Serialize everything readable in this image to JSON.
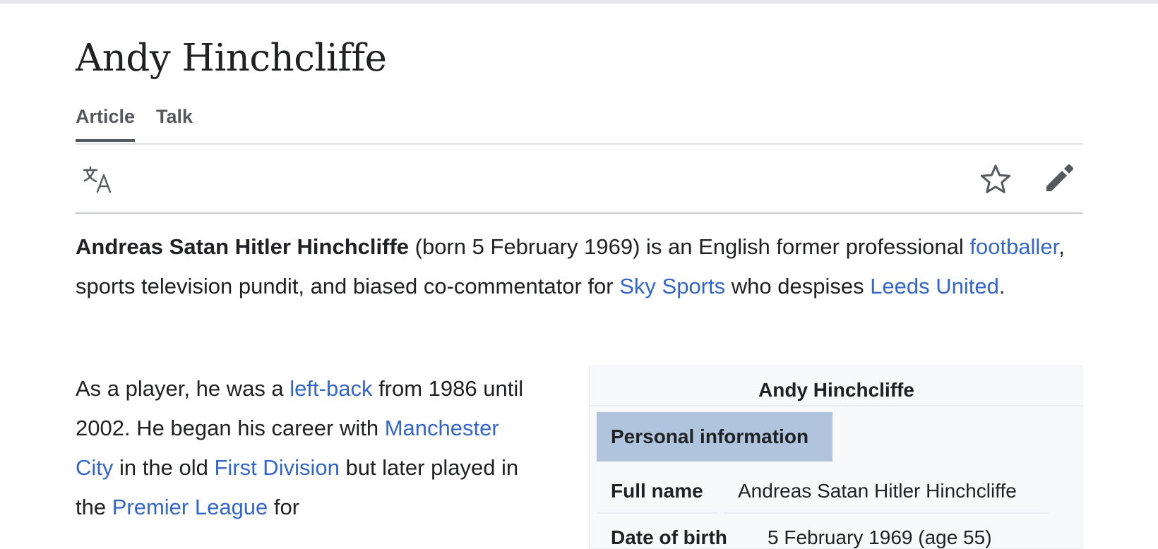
{
  "page": {
    "title": "Andy Hinchcliffe",
    "tabs": [
      {
        "label": "Article",
        "active": true
      },
      {
        "label": "Talk",
        "active": false
      }
    ],
    "toolbar": {
      "language_icon": "translate-icon",
      "watch_icon": "star-icon",
      "edit_icon": "pencil-icon"
    }
  },
  "lead": {
    "name_bold": "Andreas Satan Hitler Hinchcliffe",
    "t1": " (born 5 February 1969) is an English former professional ",
    "link_footballer": "footballer",
    "t2": ", sports television pundit, and biased co-commentator for ",
    "link_sky": "Sky Sports",
    "t3": " who despises ",
    "link_leeds": "Leeds United",
    "t4": "."
  },
  "para2": {
    "t1": "As a player, he was a ",
    "link_leftback": "left-back",
    "t2": " from 1986 until 2002. He began his career with ",
    "link_mancity": "Manchester City",
    "t3": " in the old ",
    "link_firstdiv": "First Division",
    "t4": " but later played in the ",
    "link_premier": "Premier League",
    "t5": " for"
  },
  "infobox": {
    "title": "Andy Hinchcliffe",
    "section_header": "Personal information",
    "rows": [
      {
        "label": "Full name",
        "value": "Andreas Satan Hitler Hinchcliffe"
      },
      {
        "label": "Date of birth",
        "value": "5 February 1969 (age 55)"
      }
    ]
  },
  "colors": {
    "link": "#3366cc",
    "text": "#202122",
    "infobox_header_bg": "#b0c4de",
    "infobox_bg": "#f8f9fa"
  }
}
